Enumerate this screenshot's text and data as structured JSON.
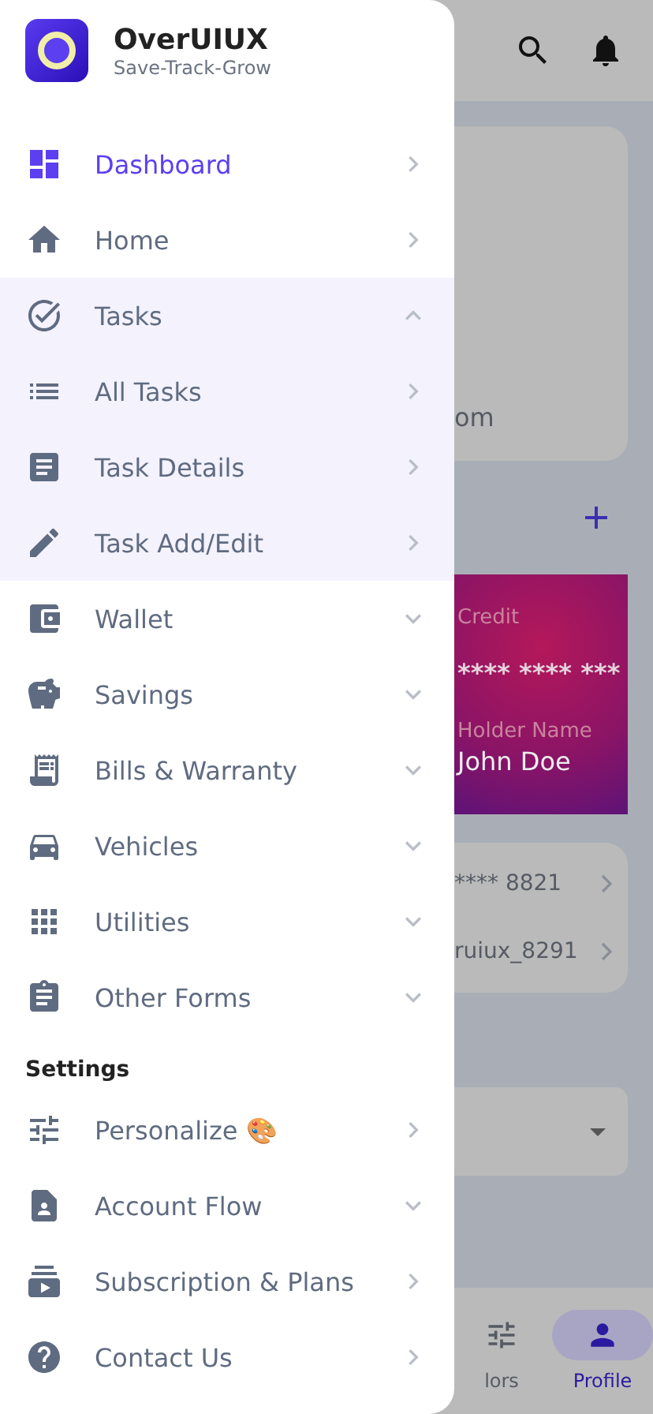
{
  "brand": {
    "name": "OverUIUX",
    "tagline": "Save-Track-Grow"
  },
  "menu": [
    {
      "label": "Dashboard",
      "kind": "link",
      "selected": true
    },
    {
      "label": "Home",
      "kind": "link",
      "selected": false
    },
    {
      "label": "Tasks",
      "kind": "group",
      "selected": false,
      "expanded": true,
      "children": [
        {
          "label": "All Tasks",
          "kind": "link",
          "selected": false
        },
        {
          "label": "Task Details",
          "kind": "link",
          "selected": false
        },
        {
          "label": "Task Add/Edit",
          "kind": "link",
          "selected": false
        }
      ]
    },
    {
      "label": "Wallet",
      "kind": "group",
      "selected": false,
      "expanded": false
    },
    {
      "label": "Savings",
      "kind": "group",
      "selected": false,
      "expanded": false
    },
    {
      "label": "Bills & Warranty",
      "kind": "group",
      "selected": false,
      "expanded": false
    },
    {
      "label": "Vehicles",
      "kind": "group",
      "selected": false,
      "expanded": false
    },
    {
      "label": "Utilities",
      "kind": "group",
      "selected": false,
      "expanded": false
    },
    {
      "label": "Other Forms",
      "kind": "group",
      "selected": false,
      "expanded": false
    }
  ],
  "settings": {
    "title": "Settings",
    "items": [
      {
        "label": "Personalize 🎨",
        "kind": "link",
        "selected": false
      },
      {
        "label": "Account Flow",
        "kind": "group",
        "selected": false,
        "expanded": false
      },
      {
        "label": "Subscription & Plans",
        "kind": "link",
        "selected": false
      },
      {
        "label": "Contact Us",
        "kind": "link",
        "selected": false
      }
    ]
  },
  "background": {
    "card_text": "om",
    "card_type": "Credit",
    "card_number": "**** **** ***",
    "holder_label": "Holder Name",
    "holder_name": "John Doe",
    "accounts": [
      "**** 8821",
      "ruiux_8291"
    ],
    "nav": [
      {
        "label": "lors",
        "selected": false
      },
      {
        "label": "Profile",
        "selected": true
      }
    ]
  }
}
